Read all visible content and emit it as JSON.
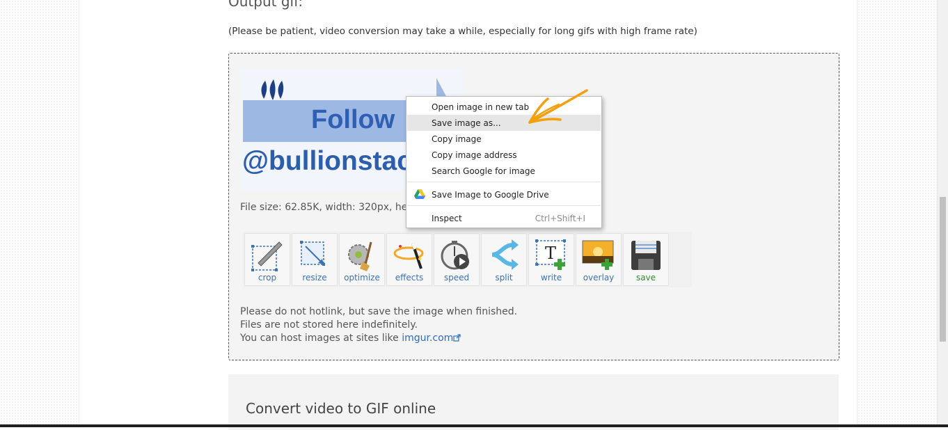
{
  "heading": "Output gif:",
  "note": "(Please be patient, video conversion may take a while, especially for long gifs with high frame rate)",
  "gif": {
    "follow_text": "Follow",
    "handle_text": "@bullionstac"
  },
  "file_info": "File size: 62.85K, width: 320px, height",
  "tools": [
    {
      "label": "crop",
      "icon": "crop-icon"
    },
    {
      "label": "resize",
      "icon": "resize-icon"
    },
    {
      "label": "optimize",
      "icon": "optimize-icon"
    },
    {
      "label": "effects",
      "icon": "effects-icon"
    },
    {
      "label": "speed",
      "icon": "speed-icon"
    },
    {
      "label": "split",
      "icon": "split-icon"
    },
    {
      "label": "write",
      "icon": "write-icon"
    },
    {
      "label": "overlay",
      "icon": "overlay-icon"
    },
    {
      "label": "save",
      "icon": "save-icon"
    }
  ],
  "info_lines": {
    "line1": "Please do not hotlink, but save the image when finished.",
    "line2": "Files are not stored here indefinitely.",
    "line3_prefix": "You can host images at sites like ",
    "link_text": "imgur.com"
  },
  "convert_title": "Convert video to GIF online",
  "context_menu": {
    "items": [
      {
        "label": "Open image in new tab"
      },
      {
        "label": "Save image as..."
      },
      {
        "label": "Copy image"
      },
      {
        "label": "Copy image address"
      },
      {
        "label": "Search Google for image"
      },
      {
        "label": "Save Image to Google Drive"
      },
      {
        "label": "Inspect",
        "shortcut": "Ctrl+Shift+I"
      }
    ]
  },
  "colors": {
    "link": "#2a6ebd",
    "annotation_arrow": "#f5a00a",
    "menu_highlight": "#e6e6e6",
    "save_label": "#2f8a2f"
  }
}
